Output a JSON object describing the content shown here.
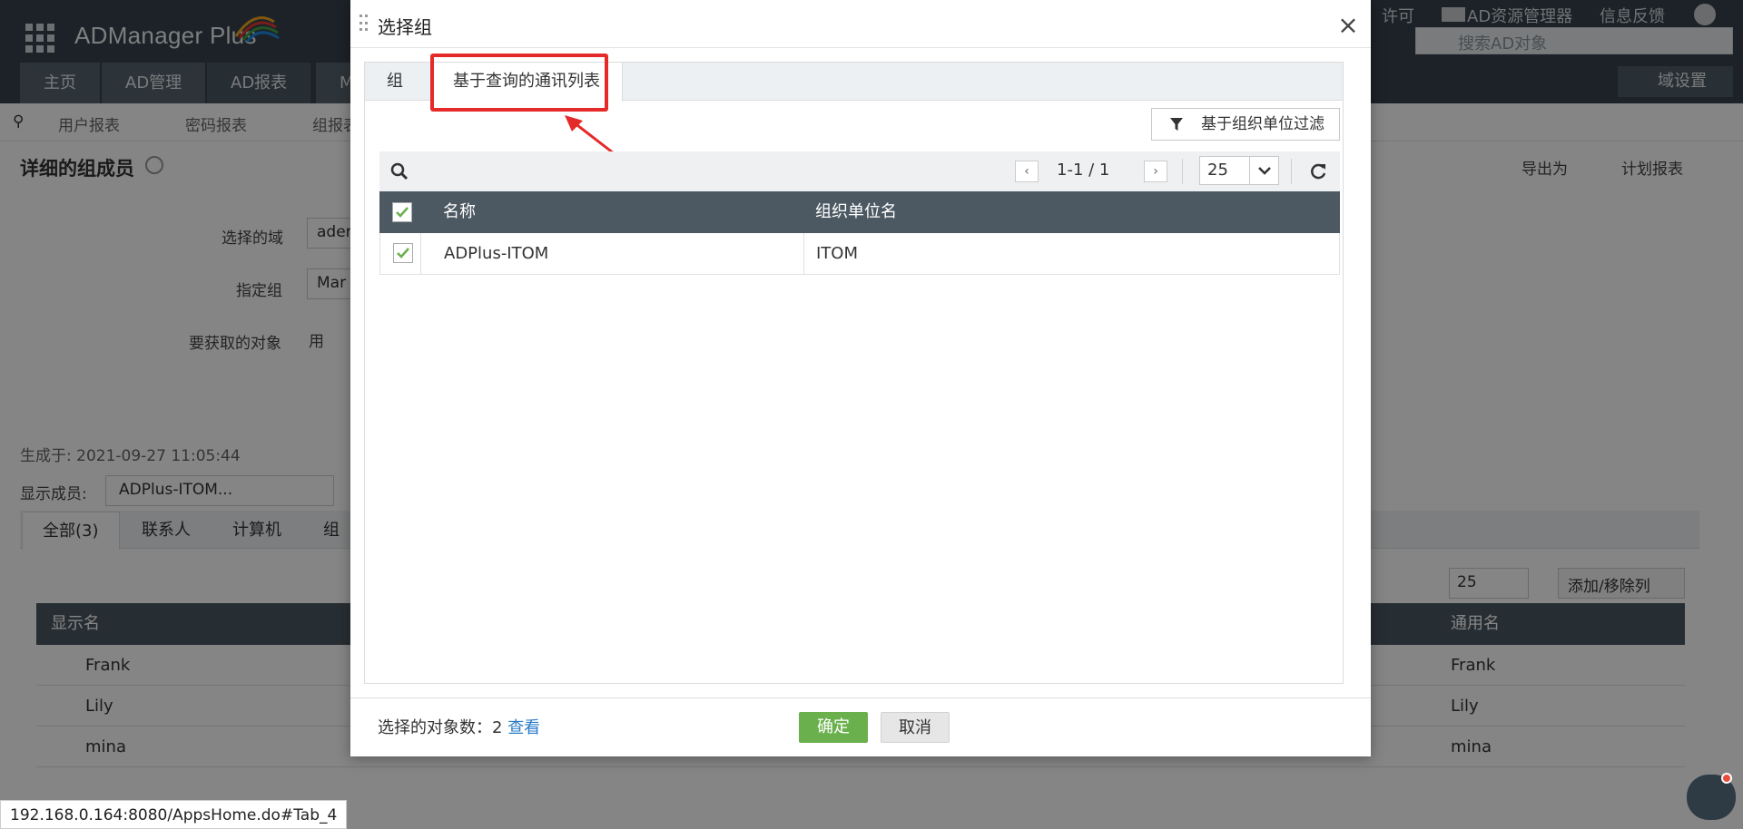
{
  "header": {
    "brand": "ADManager Plus",
    "links": [
      "许可",
      "AD资源管理器",
      "信息反馈"
    ],
    "search_placeholder": "搜索AD对象",
    "domain_settings": "域设置"
  },
  "nav": {
    "tabs": [
      "主页",
      "AD管理",
      "AD报表",
      "M"
    ]
  },
  "subnav": {
    "items": [
      "用户报表",
      "密码报表",
      "组报表"
    ]
  },
  "page": {
    "title": "详细的组成员",
    "export": "导出为",
    "schedule": "计划报表",
    "fields": {
      "domain_label": "选择的域",
      "domain_value": "ader",
      "group_label": "指定组",
      "group_value": "Mar",
      "objects_label": "要获取的对象",
      "objects_value": "用"
    },
    "generated": "生成于: 2021-09-27 11:05:44",
    "show_members_label": "显示成员:",
    "show_members_value": "ADPlus-ITOM...",
    "tabs": [
      "全部(3)",
      "联系人",
      "计算机",
      "组"
    ],
    "page_size": "25",
    "add_remove_cols": "添加/移除列",
    "columns": {
      "display_name": "显示名",
      "common_name": "通用名"
    },
    "rows": [
      {
        "display": "Frank",
        "common": "Frank"
      },
      {
        "display": "Lily",
        "common": "Lily"
      },
      {
        "display": "mina",
        "common": "mina"
      }
    ]
  },
  "modal": {
    "title": "选择组",
    "close": "×",
    "tabs": [
      "组",
      "基于查询的通讯列表"
    ],
    "filter_btn": "基于组织单位过滤",
    "pager": "1-1 / 1",
    "page_size": "25",
    "columns": {
      "name": "名称",
      "ou": "组织单位名"
    },
    "rows": [
      {
        "name": "ADPlus-ITOM",
        "ou": "ITOM"
      }
    ],
    "selected_count_label": "选择的对象数：2",
    "view_link": "查看",
    "ok": "确定",
    "cancel": "取消"
  },
  "status_url": "192.168.0.164:8080/AppsHome.do#Tab_4"
}
